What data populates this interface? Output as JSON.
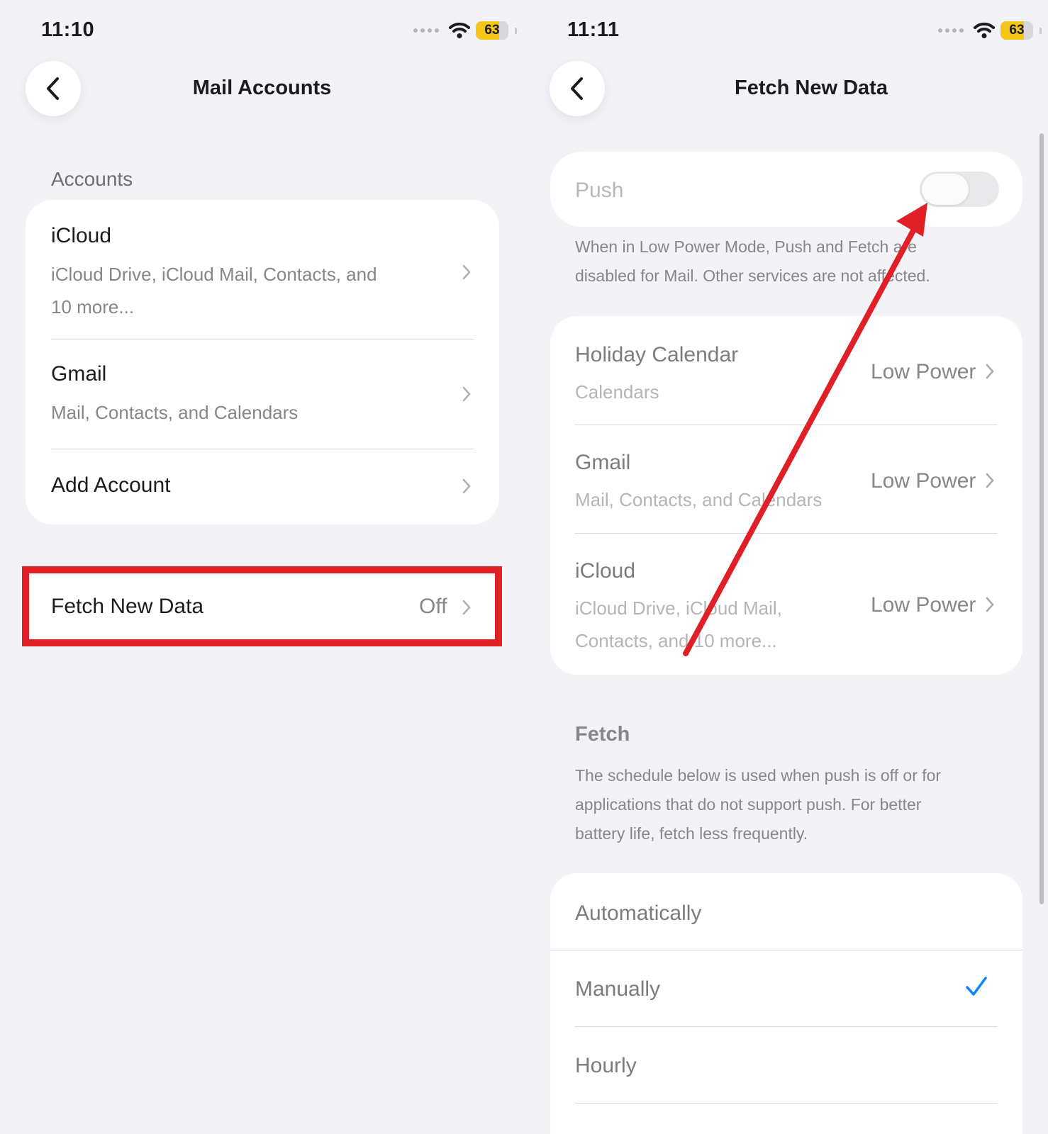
{
  "left": {
    "status": {
      "time": "11:10",
      "battery": "63"
    },
    "nav": {
      "title": "Mail Accounts"
    },
    "accounts_header": "Accounts",
    "accounts": [
      {
        "title": "iCloud",
        "subtitle_line1": "iCloud Drive, iCloud Mail, Contacts, and",
        "subtitle_line2": "10 more..."
      },
      {
        "title": "Gmail",
        "subtitle_line1": "Mail, Contacts, and Calendars"
      },
      {
        "title": "Add Account"
      }
    ],
    "fetch": {
      "label": "Fetch New Data",
      "value": "Off"
    }
  },
  "right": {
    "status": {
      "time": "11:11",
      "battery": "63"
    },
    "nav": {
      "title": "Fetch New Data"
    },
    "push": {
      "label": "Push",
      "enabled": false
    },
    "push_note_line1": "When in Low Power Mode, Push and Fetch are",
    "push_note_line2": "disabled for Mail.  Other services are not affected.",
    "accounts": [
      {
        "title": "Holiday Calendar",
        "subtitle_line1": "Calendars",
        "value": "Low Power"
      },
      {
        "title": "Gmail",
        "subtitle_line1": "Mail, Contacts, and Calendars",
        "value": "Low Power"
      },
      {
        "title": "iCloud",
        "subtitle_line1": "iCloud Drive, iCloud Mail,",
        "subtitle_line2": "Contacts, and 10 more...",
        "value": "Low Power"
      }
    ],
    "fetch_header": "Fetch",
    "fetch_note_line1": "The schedule below is used when push is off or for",
    "fetch_note_line2": "applications that do not support push. For better",
    "fetch_note_line3": "battery life, fetch less frequently.",
    "schedule": [
      {
        "label": "Automatically",
        "selected": false
      },
      {
        "label": "Manually",
        "selected": true
      },
      {
        "label": "Hourly",
        "selected": false
      }
    ]
  },
  "colors": {
    "highlight": "#e01f26",
    "check": "#0a84ff",
    "battery": "#f5c518"
  }
}
